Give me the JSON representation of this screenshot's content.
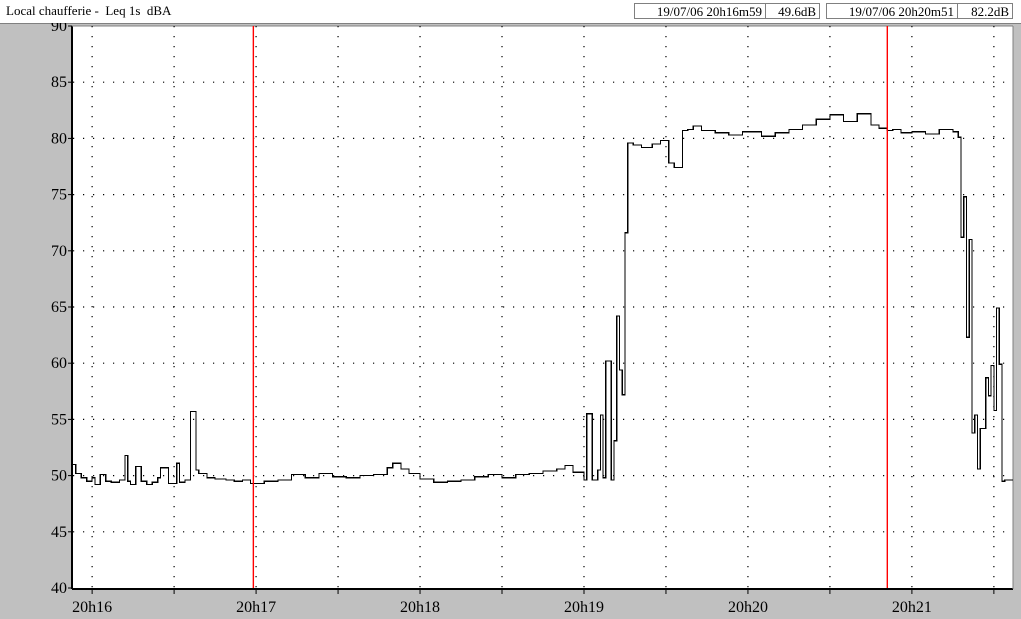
{
  "header": {
    "title": "Local chaufferie -  Leq 1s  dBA",
    "cursor1": {
      "time": "19/07/06 20h16m59",
      "value": "49.6dB"
    },
    "cursor2": {
      "time": "19/07/06 20h20m51",
      "value": "82.2dB"
    }
  },
  "colors": {
    "plot_bg": "#ffffff",
    "frame_bg": "#c0c0c0",
    "line": "#000000",
    "cursor": "#ff0000",
    "grid": "#000000"
  },
  "chart_data": {
    "type": "line",
    "title": "Local chaufferie -  Leq 1s  dBA",
    "xlabel": "",
    "ylabel": "",
    "ylim": [
      40,
      90
    ],
    "yticks": [
      40,
      45,
      50,
      55,
      60,
      65,
      70,
      75,
      80,
      85,
      90
    ],
    "xlim": [
      "20h15m53",
      "20h21m37"
    ],
    "xticks": [
      {
        "label": "20h16",
        "t": "20h16m00"
      },
      {
        "label": "20h17",
        "t": "20h17m00"
      },
      {
        "label": "20h18",
        "t": "20h18m00"
      },
      {
        "label": "20h19",
        "t": "20h19m00"
      },
      {
        "label": "20h20",
        "t": "20h20m00"
      },
      {
        "label": "20h21",
        "t": "20h21m00"
      }
    ],
    "grid": true,
    "cursors": [
      "20h16m59",
      "20h20m51"
    ],
    "step": true,
    "series": [
      {
        "x": [
          "20h15m53",
          "20h15m54",
          "20h15m56",
          "20h15m58",
          "20h16m00",
          "20h16m01",
          "20h16m03",
          "20h16m05",
          "20h16m07",
          "20h16m10",
          "20h16m12",
          "20h16m13",
          "20h16m14",
          "20h16m16",
          "20h16m18",
          "20h16m20",
          "20h16m22",
          "20h16m24",
          "20h16m25",
          "20h16m28",
          "20h16m31",
          "20h16m32",
          "20h16m34",
          "20h16m36",
          "20h16m38",
          "20h16m39",
          "20h16m42",
          "20h16m45",
          "20h16m49",
          "20h16m52",
          "20h16m55",
          "20h16m58",
          "20h17m03",
          "20h17m08",
          "20h17m13",
          "20h17m18",
          "20h17m23",
          "20h17m28",
          "20h17m33",
          "20h17m38",
          "20h17m43",
          "20h17m48",
          "20h17m50",
          "20h17m53",
          "20h17m56",
          "20h18m00",
          "20h18m05",
          "20h18m10",
          "20h18m15",
          "20h18m20",
          "20h18m25",
          "20h18m30",
          "20h18m35",
          "20h18m40",
          "20h18m45",
          "20h18m50",
          "20h18m53",
          "20h18m56",
          "20h19m00",
          "20h19m01",
          "20h19m03",
          "20h19m05",
          "20h19m06",
          "20h19m07",
          "20h19m08",
          "20h19m10",
          "20h19m11",
          "20h19m12",
          "20h19m13",
          "20h19m14",
          "20h19m15",
          "20h19m16",
          "20h19m18",
          "20h19m21",
          "20h19m25",
          "20h19m28",
          "20h19m31",
          "20h19m33",
          "20h19m36",
          "20h19m38",
          "20h19m40",
          "20h19m43",
          "20h19m48",
          "20h19m53",
          "20h19m58",
          "20h20m05",
          "20h20m10",
          "20h20m15",
          "20h20m20",
          "20h20m25",
          "20h20m30",
          "20h20m35",
          "20h20m40",
          "20h20m45",
          "20h20m48",
          "20h20m51",
          "20h20m53",
          "20h20m56",
          "20h21m00",
          "20h21m05",
          "20h21m10",
          "20h21m15",
          "20h21m17",
          "20h21m18",
          "20h21m19",
          "20h21m20",
          "20h21m21",
          "20h21m22",
          "20h21m23",
          "20h21m24",
          "20h21m25",
          "20h21m27",
          "20h21m28",
          "20h21m29",
          "20h21m30",
          "20h21m31",
          "20h21m32",
          "20h21m33",
          "20h21m34",
          "20h21m35",
          "20h21m36"
        ],
        "y": [
          51,
          50.2,
          49.8,
          49.5,
          49.8,
          49.2,
          50.1,
          49.5,
          49.4,
          49.6,
          51.8,
          49.5,
          49.2,
          50.8,
          49.5,
          49.2,
          49.4,
          49.8,
          50.7,
          49.3,
          51.1,
          49.4,
          49.6,
          55.7,
          50.5,
          50.2,
          49.8,
          49.7,
          49.6,
          49.5,
          49.6,
          49.3,
          49.5,
          49.6,
          50.1,
          49.8,
          50.2,
          49.9,
          49.8,
          50,
          50.1,
          50.7,
          51.1,
          50.6,
          50.2,
          49.7,
          49.4,
          49.5,
          49.6,
          49.9,
          50.1,
          49.8,
          50.1,
          50.2,
          50.4,
          50.6,
          50.9,
          50.3,
          49.6,
          55.5,
          49.6,
          50.5,
          55.4,
          49.8,
          60.2,
          49.6,
          53.1,
          64.2,
          59.4,
          57.2,
          71.6,
          79.6,
          79.4,
          79.2,
          79.5,
          79.8,
          77.8,
          77.4,
          80.7,
          80.8,
          81.1,
          80.7,
          80.5,
          80.3,
          80.6,
          80.2,
          80.5,
          80.8,
          81.2,
          81.7,
          82.1,
          81.5,
          82.2,
          81.2,
          80.9,
          80.7,
          80.8,
          80.5,
          80.6,
          80.4,
          80.8,
          80.6,
          80.1,
          71.2,
          74.8,
          62.3,
          71,
          53.8,
          55.4,
          50.6,
          54.2,
          58.7,
          57.1,
          59.8,
          55.8,
          64.9,
          59.9,
          49.5,
          49.6,
          49.6,
          49.6
        ]
      }
    ]
  }
}
